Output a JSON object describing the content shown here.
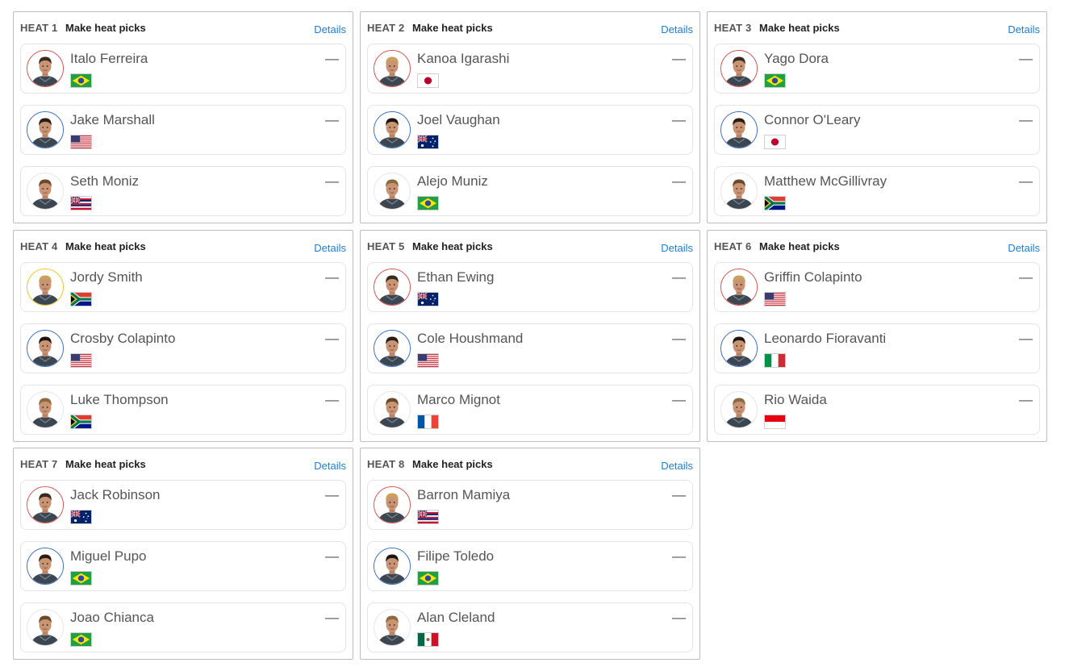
{
  "heats_header": {
    "picks_label": "Make heat picks",
    "details_label": "Details"
  },
  "heats": [
    {
      "label": "HEAT 1",
      "athletes": [
        {
          "name": "Italo Ferreira",
          "country": "brazil",
          "ring": "red",
          "score": "—"
        },
        {
          "name": "Jake Marshall",
          "country": "usa",
          "ring": "blue",
          "score": "—"
        },
        {
          "name": "Seth Moniz",
          "country": "hawaii",
          "ring": "none",
          "score": "—"
        }
      ]
    },
    {
      "label": "HEAT 2",
      "athletes": [
        {
          "name": "Kanoa Igarashi",
          "country": "japan",
          "ring": "red",
          "score": "—"
        },
        {
          "name": "Joel Vaughan",
          "country": "australia",
          "ring": "blue",
          "score": "—"
        },
        {
          "name": "Alejo Muniz",
          "country": "brazil",
          "ring": "none",
          "score": "—"
        }
      ]
    },
    {
      "label": "HEAT 3",
      "athletes": [
        {
          "name": "Yago Dora",
          "country": "brazil",
          "ring": "red",
          "score": "—"
        },
        {
          "name": "Connor O'Leary",
          "country": "japan",
          "ring": "blue",
          "score": "—"
        },
        {
          "name": "Matthew McGillivray",
          "country": "south-africa",
          "ring": "none",
          "score": "—"
        }
      ]
    },
    {
      "label": "HEAT 4",
      "athletes": [
        {
          "name": "Jordy Smith",
          "country": "south-africa",
          "ring": "yellow",
          "score": "—"
        },
        {
          "name": "Crosby Colapinto",
          "country": "usa",
          "ring": "blue",
          "score": "—"
        },
        {
          "name": "Luke Thompson",
          "country": "south-africa",
          "ring": "none",
          "score": "—"
        }
      ]
    },
    {
      "label": "HEAT 5",
      "athletes": [
        {
          "name": "Ethan Ewing",
          "country": "australia",
          "ring": "red",
          "score": "—"
        },
        {
          "name": "Cole Houshmand",
          "country": "usa",
          "ring": "blue",
          "score": "—"
        },
        {
          "name": "Marco Mignot",
          "country": "france",
          "ring": "none",
          "score": "—"
        }
      ]
    },
    {
      "label": "HEAT 6",
      "athletes": [
        {
          "name": "Griffin Colapinto",
          "country": "usa",
          "ring": "red",
          "score": "—"
        },
        {
          "name": "Leonardo Fioravanti",
          "country": "italy",
          "ring": "blue",
          "score": "—"
        },
        {
          "name": "Rio Waida",
          "country": "indonesia",
          "ring": "none",
          "score": "—"
        }
      ]
    },
    {
      "label": "HEAT 7",
      "athletes": [
        {
          "name": "Jack Robinson",
          "country": "australia",
          "ring": "red",
          "score": "—"
        },
        {
          "name": "Miguel Pupo",
          "country": "brazil",
          "ring": "blue",
          "score": "—"
        },
        {
          "name": "Joao Chianca",
          "country": "brazil",
          "ring": "none",
          "score": "—"
        }
      ]
    },
    {
      "label": "HEAT 8",
      "athletes": [
        {
          "name": "Barron Mamiya",
          "country": "hawaii",
          "ring": "red",
          "score": "—"
        },
        {
          "name": "Filipe Toledo",
          "country": "brazil",
          "ring": "blue",
          "score": "—"
        },
        {
          "name": "Alan Cleland",
          "country": "mexico",
          "ring": "none",
          "score": "—"
        }
      ]
    }
  ],
  "colors": {
    "link": "#1a7fd4",
    "ring_red": "#d9534f",
    "ring_blue": "#3a6fc9",
    "ring_yellow": "#f2c51d"
  }
}
